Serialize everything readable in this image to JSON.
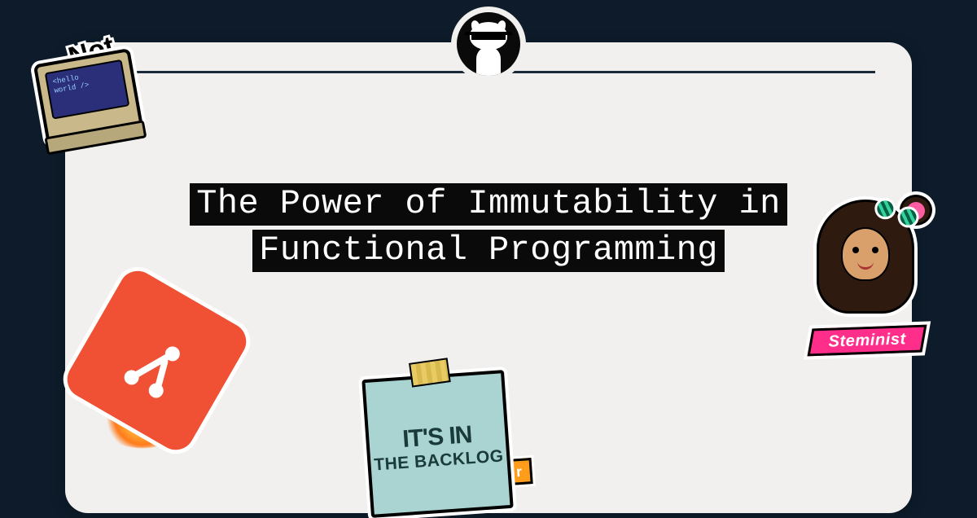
{
  "title": "The Power of Immutability in Functional Programming",
  "stickers": {
    "retro_screen_line1": "<hello",
    "retro_screen_line2": " world />",
    "backlog_line1": "IT'S IN",
    "backlog_line2": "THE BACKLOG",
    "backlog_tag": "r",
    "steminist_banner": "Steminist"
  }
}
